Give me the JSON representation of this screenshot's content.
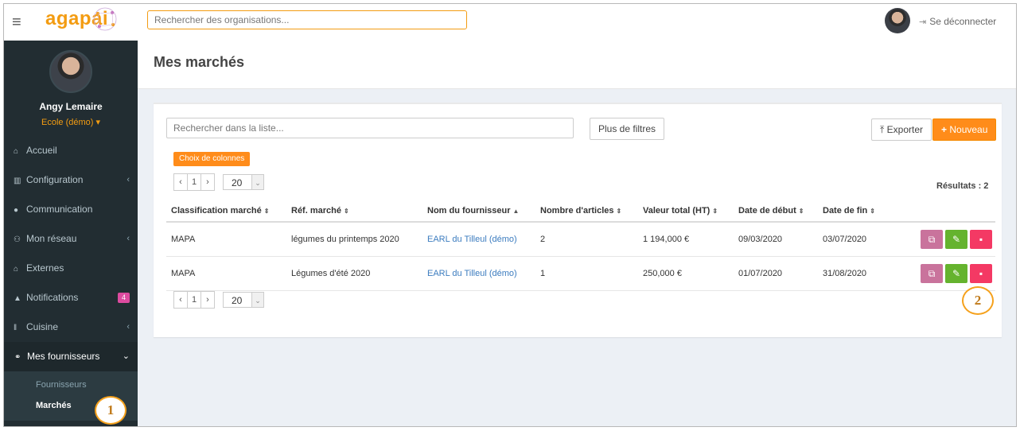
{
  "topbar": {
    "logo": "agapai",
    "search_placeholder": "Rechercher des organisations...",
    "logout_label": "Se déconnecter"
  },
  "sidebar": {
    "user_name": "Angy Lemaire",
    "user_org": "Ecole (démo) ▾",
    "items": [
      {
        "label": "Accueil"
      },
      {
        "label": "Configuration"
      },
      {
        "label": "Communication"
      },
      {
        "label": "Mon réseau"
      },
      {
        "label": "Externes"
      },
      {
        "label": "Notifications",
        "badge": "4"
      },
      {
        "label": "Cuisine"
      },
      {
        "label": "Mes fournisseurs"
      }
    ],
    "submenu": [
      "Fournisseurs",
      "Marchés"
    ]
  },
  "page": {
    "title": "Mes marchés"
  },
  "toolbar": {
    "search_placeholder": "Rechercher dans la liste...",
    "filters_label": "Plus de filtres",
    "export_label": "Exporter",
    "new_label": "Nouveau",
    "columns_label": "Choix de colonnes"
  },
  "pagination": {
    "prev": "‹",
    "page": "1",
    "next": "›",
    "page_size": "20",
    "results_label": "Résultats : 2"
  },
  "table": {
    "columns": [
      "Classification marché",
      "Réf. marché",
      "Nom du fournisseur",
      "Nombre d'articles",
      "Valeur total (HT)",
      "Date de début",
      "Date de fin"
    ],
    "rows": [
      [
        "MAPA",
        "légumes du printemps 2020",
        "EARL du Tilleul (démo)",
        "2",
        "1 194,000 €",
        "09/03/2020",
        "03/07/2020"
      ],
      [
        "MAPA",
        "Légumes d'été 2020",
        "EARL du Tilleul (démo)",
        "1",
        "250,000 €",
        "01/07/2020",
        "31/08/2020"
      ]
    ]
  },
  "annotations": [
    "1",
    "2"
  ],
  "colors": {
    "accent": "#ff8c1a",
    "sidebar": "#222d32",
    "copy": "#c9739c",
    "edit": "#65b32e",
    "delete": "#f43964",
    "link": "#3c7cbf"
  }
}
